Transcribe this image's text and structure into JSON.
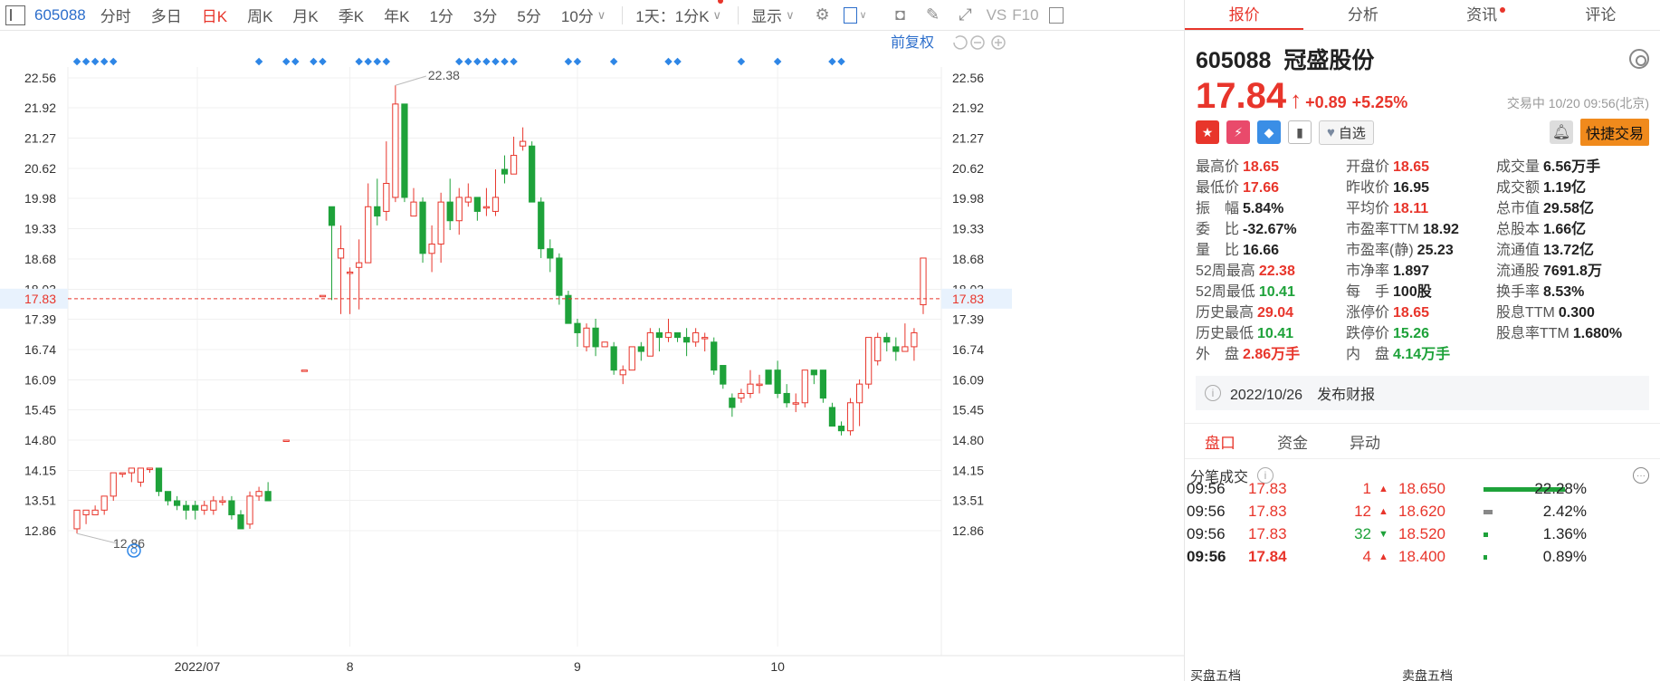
{
  "toolbar": {
    "code": "605088",
    "tabs": [
      "分时",
      "多日",
      "日K",
      "周K",
      "月K",
      "季K",
      "年K",
      "1分",
      "3分",
      "5分",
      "10分"
    ],
    "active_tab": "日K",
    "range_select": "1天：1分K",
    "display_label": "显示",
    "vs_label": "VS",
    "f10_label": "F10"
  },
  "chart_header": {
    "adjust_label": "前复权"
  },
  "chart_data": {
    "type": "candlestick",
    "y_ticks": [
      "22.56",
      "21.92",
      "21.27",
      "20.62",
      "19.98",
      "19.33",
      "18.68",
      "18.03",
      "17.39",
      "16.74",
      "16.09",
      "15.45",
      "14.80",
      "14.15",
      "13.51",
      "12.86"
    ],
    "y_range": [
      12.86,
      22.56
    ],
    "x_labels": [
      "2022/07",
      "8",
      "9",
      "10"
    ],
    "current_price_line": "17.83",
    "max_label": "22.38",
    "min_label": "12.86",
    "candles": [
      [
        12.9,
        13.3,
        12.8,
        13.3
      ],
      [
        13.2,
        13.3,
        13.0,
        13.3
      ],
      [
        13.2,
        13.3,
        13.2,
        13.4
      ],
      [
        13.3,
        13.6,
        13.2,
        13.6
      ],
      [
        13.6,
        14.1,
        13.5,
        14.1
      ],
      [
        14.1,
        14.1,
        14.0,
        14.1
      ],
      [
        14.1,
        14.2,
        13.9,
        14.2
      ],
      [
        13.9,
        14.2,
        13.8,
        14.2
      ],
      [
        14.2,
        14.2,
        14.1,
        14.2
      ],
      [
        14.2,
        13.7,
        13.6,
        14.2
      ],
      [
        13.7,
        13.5,
        13.4,
        13.7
      ],
      [
        13.5,
        13.4,
        13.3,
        13.6
      ],
      [
        13.4,
        13.3,
        13.1,
        13.5
      ],
      [
        13.4,
        13.3,
        13.1,
        13.5
      ],
      [
        13.3,
        13.4,
        13.2,
        13.5
      ],
      [
        13.3,
        13.5,
        13.2,
        13.6
      ],
      [
        13.5,
        13.5,
        13.4,
        13.6
      ],
      [
        13.5,
        13.2,
        13.1,
        13.6
      ],
      [
        13.2,
        12.9,
        12.9,
        13.3
      ],
      [
        13.0,
        13.6,
        12.9,
        13.7
      ],
      [
        13.6,
        13.7,
        13.5,
        13.8
      ],
      [
        13.7,
        13.5,
        13.5,
        13.9
      ],
      null,
      [
        14.8,
        14.8,
        14.8,
        14.8
      ],
      null,
      [
        16.3,
        16.3,
        16.3,
        16.3
      ],
      null,
      [
        17.9,
        17.9,
        17.9,
        17.9
      ],
      [
        19.8,
        19.4,
        17.8,
        19.8
      ],
      [
        18.7,
        18.9,
        17.5,
        19.4
      ],
      [
        18.4,
        18.4,
        17.5,
        18.5
      ],
      [
        18.5,
        18.6,
        17.6,
        19.1
      ],
      [
        18.6,
        19.8,
        18.6,
        20.3
      ],
      [
        19.8,
        19.6,
        19.4,
        20.4
      ],
      [
        19.7,
        20.3,
        19.5,
        21.2
      ],
      [
        20.0,
        22.0,
        19.9,
        22.4
      ],
      [
        22.0,
        20.0,
        19.9,
        22.0
      ],
      [
        19.6,
        19.9,
        19.6,
        20.2
      ],
      [
        19.9,
        18.8,
        18.6,
        20.0
      ],
      [
        18.8,
        19.0,
        18.4,
        19.4
      ],
      [
        19.0,
        19.9,
        18.6,
        20.1
      ],
      [
        19.9,
        19.5,
        19.3,
        20.4
      ],
      [
        19.5,
        20.0,
        19.2,
        20.2
      ],
      [
        19.9,
        20.0,
        19.8,
        20.3
      ],
      [
        20.0,
        19.7,
        19.5,
        20.0
      ],
      [
        19.8,
        19.8,
        19.6,
        20.2
      ],
      [
        19.7,
        20.0,
        19.6,
        20.6
      ],
      [
        20.6,
        20.5,
        20.3,
        20.9
      ],
      [
        20.5,
        20.9,
        20.5,
        21.3
      ],
      [
        21.1,
        21.2,
        21.0,
        21.5
      ],
      [
        21.1,
        19.9,
        19.9,
        21.2
      ],
      [
        19.9,
        18.9,
        18.7,
        20.0
      ],
      [
        18.9,
        18.7,
        18.4,
        19.1
      ],
      [
        18.7,
        17.9,
        17.7,
        18.8
      ],
      [
        17.9,
        17.3,
        17.3,
        18.0
      ],
      [
        17.3,
        17.1,
        16.8,
        17.4
      ],
      [
        16.8,
        17.2,
        16.7,
        17.3
      ],
      [
        17.2,
        16.8,
        16.6,
        17.4
      ],
      [
        16.8,
        16.9,
        16.8,
        16.9
      ],
      [
        16.8,
        16.3,
        16.2,
        16.9
      ],
      [
        16.2,
        16.3,
        16.0,
        16.4
      ],
      [
        16.3,
        16.8,
        16.3,
        16.8
      ],
      [
        16.8,
        16.7,
        16.5,
        16.9
      ],
      [
        16.6,
        17.1,
        16.6,
        17.2
      ],
      [
        17.1,
        17.0,
        16.7,
        17.2
      ],
      [
        17.0,
        17.1,
        16.9,
        17.4
      ],
      [
        17.1,
        17.0,
        16.9,
        17.1
      ],
      [
        17.0,
        16.9,
        16.6,
        17.2
      ],
      [
        16.9,
        17.1,
        16.8,
        17.2
      ],
      [
        17.0,
        17.0,
        16.7,
        17.1
      ],
      [
        16.9,
        16.3,
        16.2,
        17.0
      ],
      [
        16.4,
        16.0,
        15.9,
        16.4
      ],
      [
        15.7,
        15.5,
        15.3,
        15.8
      ],
      [
        15.7,
        15.8,
        15.6,
        15.9
      ],
      [
        15.8,
        16.0,
        15.7,
        16.3
      ],
      [
        16.0,
        16.0,
        15.8,
        16.2
      ],
      [
        16.3,
        16.0,
        16.0,
        16.3
      ],
      [
        16.3,
        15.8,
        15.7,
        16.5
      ],
      [
        15.8,
        15.6,
        15.5,
        16.0
      ],
      [
        15.6,
        15.6,
        15.4,
        15.8
      ],
      [
        15.6,
        16.3,
        15.5,
        16.3
      ],
      [
        16.3,
        16.2,
        16.0,
        16.3
      ],
      [
        16.3,
        15.7,
        15.6,
        16.3
      ],
      [
        15.5,
        15.1,
        15.1,
        15.6
      ],
      [
        15.1,
        15.0,
        14.9,
        15.2
      ],
      [
        15.0,
        15.6,
        14.9,
        15.7
      ],
      [
        15.6,
        16.0,
        15.1,
        16.1
      ],
      [
        16.0,
        17.0,
        15.9,
        17.0
      ],
      [
        16.5,
        17.0,
        16.4,
        17.1
      ],
      [
        17.0,
        16.9,
        16.7,
        17.1
      ],
      [
        16.8,
        16.7,
        16.5,
        17.0
      ],
      [
        16.7,
        16.8,
        16.7,
        17.3
      ],
      [
        16.8,
        17.1,
        16.5,
        17.2
      ],
      [
        17.7,
        18.7,
        17.5,
        18.7
      ]
    ],
    "marker_dates": [
      0,
      1,
      2,
      3,
      4,
      20,
      23,
      24,
      26,
      27,
      31,
      32,
      33,
      34,
      42,
      43,
      44,
      45,
      46,
      47,
      48,
      54,
      55,
      59,
      65,
      66,
      73,
      77,
      83,
      84
    ]
  },
  "panel": {
    "tabs": [
      "报价",
      "分析",
      "资讯",
      "评论"
    ],
    "code": "605088",
    "name": "冠盛股份",
    "price": "17.84",
    "arrow": "↑",
    "change": "+0.89",
    "change_pct": "+5.25%",
    "status_time": "交易中 10/20 09:56(北京)",
    "watch_label": "自选",
    "fast_trade": "快捷交易",
    "quotes": [
      [
        {
          "k": "最高价",
          "v": "18.65",
          "c": "red"
        },
        {
          "k": "开盘价",
          "v": "18.65",
          "c": "red"
        },
        {
          "k": "成交量",
          "v": "6.56万手",
          "c": ""
        }
      ],
      [
        {
          "k": "最低价",
          "v": "17.66",
          "c": "red"
        },
        {
          "k": "昨收价",
          "v": "16.95",
          "c": ""
        },
        {
          "k": "成交额",
          "v": "1.19亿",
          "c": ""
        }
      ],
      [
        {
          "k": "振　幅",
          "v": "5.84%",
          "c": ""
        },
        {
          "k": "平均价",
          "v": "18.11",
          "c": "red"
        },
        {
          "k": "总市值",
          "v": "29.58亿",
          "c": ""
        }
      ],
      [
        {
          "k": "委　比",
          "v": "-32.67%",
          "c": ""
        },
        {
          "k": "市盈率TTM",
          "v": "18.92",
          "c": ""
        },
        {
          "k": "总股本",
          "v": "1.66亿",
          "c": ""
        }
      ],
      [
        {
          "k": "量　比",
          "v": "16.66",
          "c": ""
        },
        {
          "k": "市盈率(静)",
          "v": "25.23",
          "c": ""
        },
        {
          "k": "流通值",
          "v": "13.72亿",
          "c": ""
        }
      ],
      [
        {
          "k": "52周最高",
          "v": "22.38",
          "c": "red"
        },
        {
          "k": "市净率",
          "v": "1.897",
          "c": ""
        },
        {
          "k": "流通股",
          "v": "7691.8万",
          "c": ""
        }
      ],
      [
        {
          "k": "52周最低",
          "v": "10.41",
          "c": "green"
        },
        {
          "k": "每　手",
          "v": "100股",
          "c": ""
        },
        {
          "k": "换手率",
          "v": "8.53%",
          "c": ""
        }
      ],
      [
        {
          "k": "历史最高",
          "v": "29.04",
          "c": "red"
        },
        {
          "k": "涨停价",
          "v": "18.65",
          "c": "red"
        },
        {
          "k": "股息TTM",
          "v": "0.300",
          "c": ""
        }
      ],
      [
        {
          "k": "历史最低",
          "v": "10.41",
          "c": "green"
        },
        {
          "k": "跌停价",
          "v": "15.26",
          "c": "green"
        },
        {
          "k": "股息率TTM",
          "v": "1.680%",
          "c": ""
        }
      ],
      [
        {
          "k": "外　盘",
          "v": "2.86万手",
          "c": "red"
        },
        {
          "k": "内　盘",
          "v": "4.14万手",
          "c": "green"
        },
        null
      ]
    ],
    "report": "2022/10/26　发布财报",
    "sub_tabs": [
      "盘口",
      "资金",
      "异动"
    ],
    "trades_title": "分笔成交",
    "trades": [
      {
        "time": "09:56",
        "price": "17.83",
        "vol": "1",
        "dir": "up"
      },
      {
        "time": "09:56",
        "price": "17.83",
        "vol": "12",
        "dir": "up"
      },
      {
        "time": "09:56",
        "price": "17.83",
        "vol": "32",
        "dir": "down"
      },
      {
        "time": "09:56",
        "price": "17.84",
        "vol": "4",
        "dir": "up"
      }
    ],
    "levels": [
      {
        "price": "18.650",
        "pct": "22.28%",
        "color": "#1ea23a",
        "frac": 1.0
      },
      {
        "price": "18.620",
        "pct": "2.42%",
        "color": "#888888",
        "frac": 0.11
      },
      {
        "price": "18.520",
        "pct": "1.36%",
        "color": "#1ea23a",
        "frac": 0.06
      },
      {
        "price": "18.400",
        "pct": "0.89%",
        "color": "#1ea23a",
        "frac": 0.04
      }
    ],
    "sell_label": "买盘五档",
    "buy_label": "卖盘五档"
  }
}
